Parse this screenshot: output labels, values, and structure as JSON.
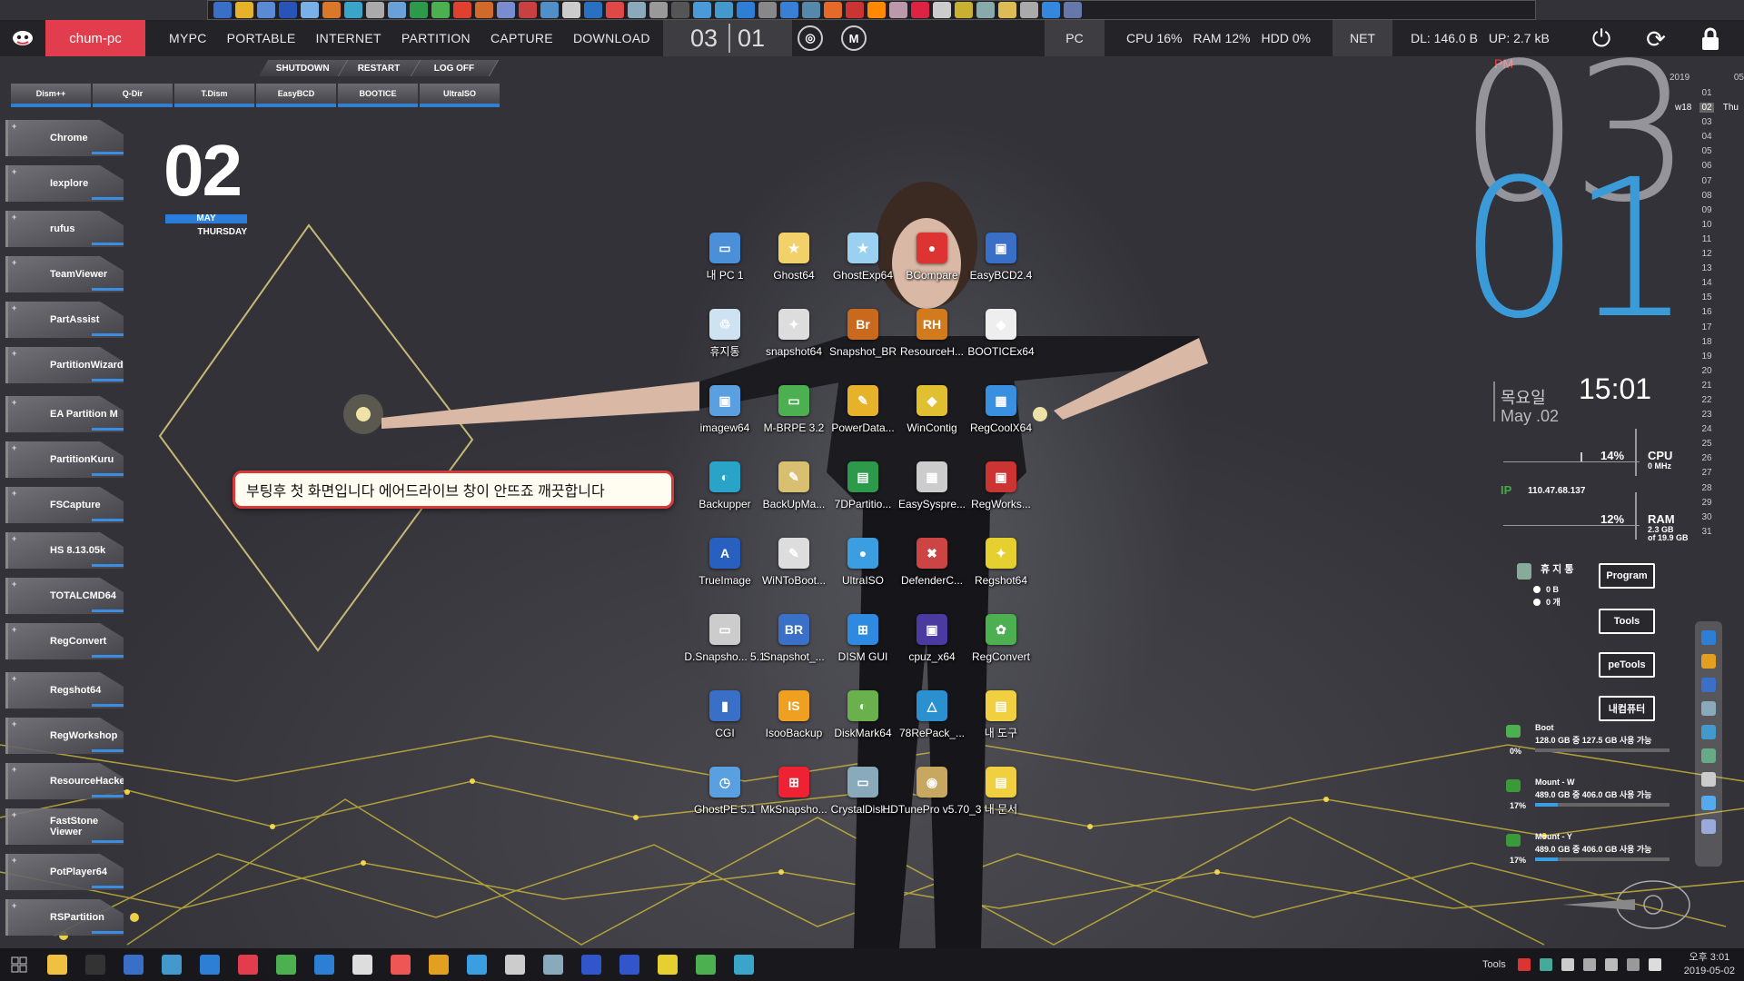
{
  "top_bar": {
    "hostname": "chum-pc",
    "menu": [
      "MYPC",
      "PORTABLE",
      "INTERNET",
      "PARTITION",
      "CAPTURE",
      "DOWNLOAD"
    ],
    "month": "03",
    "day": "01",
    "pc_label": "PC",
    "cpu": "CPU  16%",
    "ram": "RAM  12%",
    "hdd": "HDD  0%",
    "net_label": "NET",
    "dl": "DL: 146.0 B",
    "up": "UP: 2.7 kB"
  },
  "commands": [
    "SHUTDOWN",
    "RESTART",
    "LOG OFF"
  ],
  "tool_buttons": [
    "Dism++",
    "Q-Dir",
    "T.Dism",
    "EasyBCD",
    "BOOTICE",
    "UltraISO"
  ],
  "sidebar_apps": [
    "Chrome",
    "Iexplore",
    "rufus",
    "TeamViewer",
    "PartAssist",
    "PartitionWizard",
    "EA Partition M",
    "PartitionKuru",
    "FSCapture",
    "HS 8.13.05k",
    "TOTALCMD64",
    "RegConvert",
    "Regshot64",
    "RegWorkshop",
    "ResourceHacker",
    "FastStone Viewer",
    "PotPlayer64",
    "RSPartition"
  ],
  "date_widget": {
    "day": "02",
    "month": "MAY",
    "weekday": "THURSDAY"
  },
  "callout_text": "부팅후 첫 화면입니다 에어드라이브 창이 안뜨죠 깨끗합니다",
  "desktop_icons": [
    {
      "label": "내 PC 1"
    },
    {
      "label": "Ghost64"
    },
    {
      "label": "GhostExp64"
    },
    {
      "label": "BCompare"
    },
    {
      "label": "EasyBCD2.4"
    },
    {
      "label": "휴지통"
    },
    {
      "label": "snapshot64"
    },
    {
      "label": "Snapshot_BR"
    },
    {
      "label": "ResourceH..."
    },
    {
      "label": "BOOTICEx64"
    },
    {
      "label": "imagew64"
    },
    {
      "label": "M-BRPE 3.2"
    },
    {
      "label": "PowerData..."
    },
    {
      "label": "WinContig"
    },
    {
      "label": "RegCoolX64"
    },
    {
      "label": "Backupper"
    },
    {
      "label": "BackUpMa..."
    },
    {
      "label": "7DPartitio..."
    },
    {
      "label": "EasySyspre..."
    },
    {
      "label": "RegWorks..."
    },
    {
      "label": "TrueImage"
    },
    {
      "label": "WiNToBoot..."
    },
    {
      "label": "UltraISO"
    },
    {
      "label": "DefenderC..."
    },
    {
      "label": "Regshot64"
    },
    {
      "label": "D.Snapsho... 5.1"
    },
    {
      "label": "Snapshot_..."
    },
    {
      "label": "DISM GUI"
    },
    {
      "label": "cpuz_x64"
    },
    {
      "label": "RegConvert"
    },
    {
      "label": "CGI"
    },
    {
      "label": "IsooBackup"
    },
    {
      "label": "DiskMark64"
    },
    {
      "label": "78RePack_..."
    },
    {
      "label": "내 도구"
    },
    {
      "label": "GhostPE 5.1"
    },
    {
      "label": "MkSnapsho..."
    },
    {
      "label": "CrystalDisk..."
    },
    {
      "label": "HDTunePro v5.70_3"
    },
    {
      "label": "내 문서"
    }
  ],
  "clock": {
    "ampm": "PM",
    "hour": "03",
    "minute": "01",
    "weekday_kr": "목요일",
    "date": "May .02",
    "time": "15:01"
  },
  "calendar": {
    "year": "2019",
    "month": "05",
    "week": "w18",
    "weekday": "Thu",
    "days": [
      "01",
      "02",
      "03",
      "04",
      "05",
      "06",
      "07",
      "08",
      "09",
      "10",
      "11",
      "12",
      "13",
      "14",
      "15",
      "16",
      "17",
      "18",
      "19",
      "20",
      "21",
      "22",
      "23",
      "24",
      "25",
      "26",
      "27",
      "28",
      "29",
      "30",
      "31"
    ]
  },
  "system": {
    "cpu_pct": "14%",
    "cpu_label": "CPU",
    "cpu_mhz": "0 MHz",
    "ip_label": "IP",
    "ip": "110.47.68.137",
    "ram_pct": "12%",
    "ram_label": "RAM",
    "ram_used": "2.3 GB",
    "ram_total": "of 19.9 GB"
  },
  "recycle": {
    "label": "휴 지 통",
    "size": "0 B",
    "count": "0 개"
  },
  "right_buttons": [
    "Program",
    "Tools",
    "peTools",
    "내컴퓨터"
  ],
  "drives": [
    {
      "name": "Boot",
      "size": "128.0 GB 중 127.5 GB 사용 가능",
      "pct": "0%",
      "fill": 0.0
    },
    {
      "name": "Mount - W",
      "size": "489.0 GB 중 406.0 GB 사용 가능",
      "pct": "17%",
      "fill": 0.17
    },
    {
      "name": "Mount - Y",
      "size": "489.0 GB 중 406.0 GB 사용 가능",
      "pct": "17%",
      "fill": 0.17
    }
  ],
  "taskbar": {
    "tools_label": "Tools",
    "time": "오후 3:01",
    "date": "2019-05-02"
  },
  "colors": {
    "accent": "#3a9ee0",
    "host_bg": "#e23d4c",
    "callout_border": "#d93939"
  }
}
